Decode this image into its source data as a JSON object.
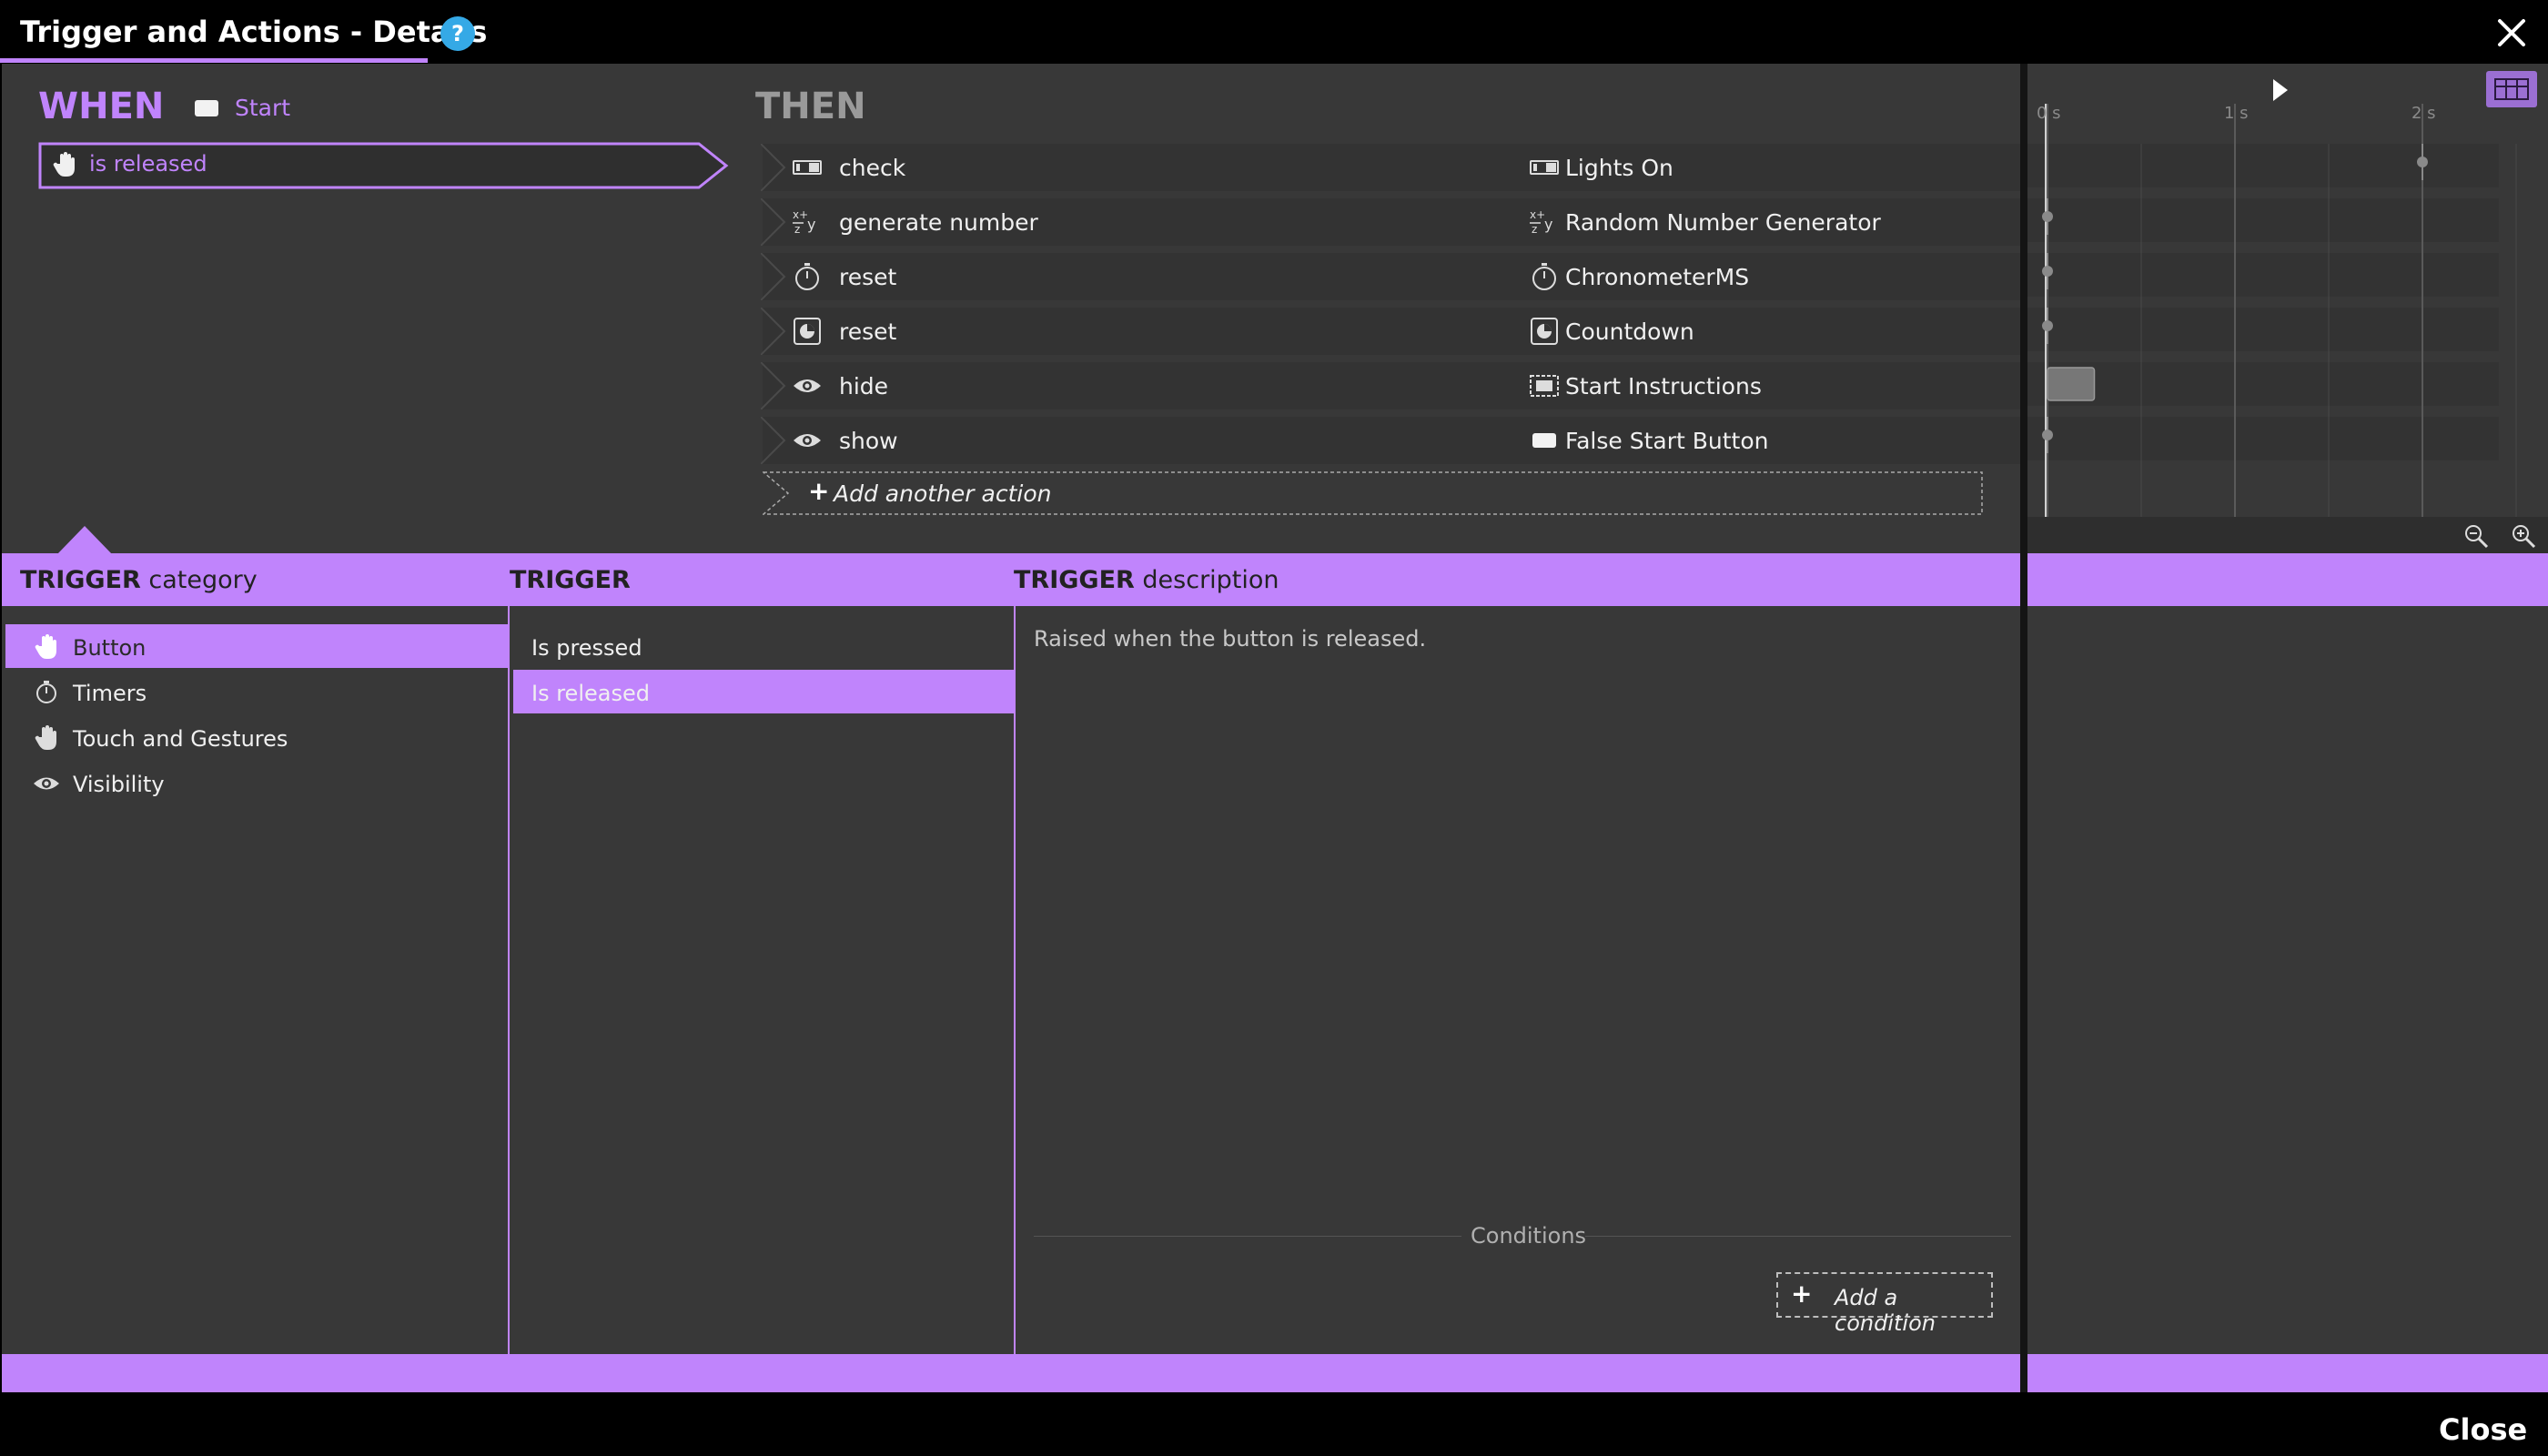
{
  "window": {
    "title": "Trigger and Actions - Details",
    "help_label": "?",
    "close_label": "Close"
  },
  "when": {
    "label": "WHEN",
    "source": {
      "icon": "button-icon",
      "name": "Start"
    },
    "trigger": {
      "icon": "hand-icon",
      "label": "is released"
    }
  },
  "then": {
    "label": "THEN",
    "actions": [
      {
        "action_icon": "toggle-icon",
        "verb": "check",
        "target_icon": "toggle-icon",
        "target": "Lights On",
        "timeline_at_s": 2.0,
        "timeline_duration_s": 0
      },
      {
        "action_icon": "formula-icon",
        "verb": "generate number",
        "target_icon": "formula-icon",
        "target": "Random Number Generator",
        "timeline_at_s": 0,
        "timeline_duration_s": 0
      },
      {
        "action_icon": "stopwatch-icon",
        "verb": "reset",
        "target_icon": "stopwatch-icon",
        "target": "ChronometerMS",
        "timeline_at_s": 0,
        "timeline_duration_s": 0
      },
      {
        "action_icon": "countdown-icon",
        "verb": "reset",
        "target_icon": "countdown-icon",
        "target": "Countdown",
        "timeline_at_s": 0,
        "timeline_duration_s": 0
      },
      {
        "action_icon": "eye-icon",
        "verb": "hide",
        "target_icon": "frame-icon",
        "target": "Start Instructions",
        "timeline_at_s": 0,
        "timeline_duration_s": 0.5
      },
      {
        "action_icon": "eye-icon",
        "verb": "show",
        "target_icon": "button-icon",
        "target": "False Start Button",
        "timeline_at_s": 0,
        "timeline_duration_s": 0
      }
    ],
    "add_action_label": "Add another action"
  },
  "timeline": {
    "ticks": [
      "0 s",
      "1 s",
      "2 s"
    ],
    "accent": "#9b6fd3"
  },
  "trigger_panel": {
    "category_header_bold": "TRIGGER",
    "category_header_rest": "category",
    "trigger_header": "TRIGGER",
    "description_header_bold": "TRIGGER",
    "description_header_rest": "description",
    "categories": [
      {
        "icon": "hand-icon",
        "label": "Button",
        "selected": true
      },
      {
        "icon": "stopwatch-icon",
        "label": "Timers",
        "selected": false
      },
      {
        "icon": "hand-icon",
        "label": "Touch and Gestures",
        "selected": false
      },
      {
        "icon": "eye-icon",
        "label": "Visibility",
        "selected": false
      }
    ],
    "triggers": [
      {
        "label": "Is pressed",
        "selected": false
      },
      {
        "label": "Is released",
        "selected": true
      }
    ],
    "description": "Raised when the button is released.",
    "conditions_label": "Conditions",
    "add_condition_label": "Add a condition"
  },
  "colors": {
    "accent": "#c084fc",
    "panel": "#383838",
    "row": "#333333",
    "help": "#35a9e6"
  }
}
